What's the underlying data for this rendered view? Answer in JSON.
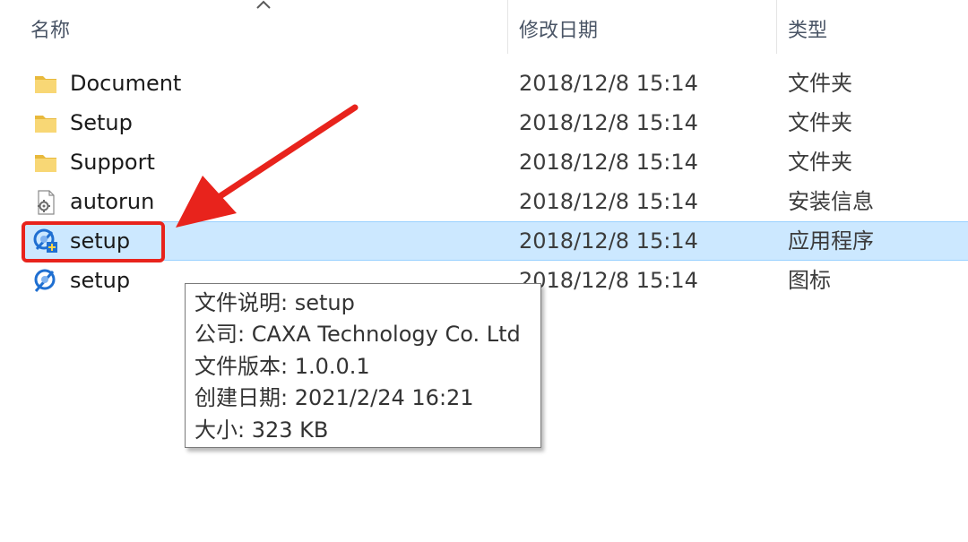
{
  "header": {
    "name_label": "名称",
    "date_label": "修改日期",
    "type_label": "类型"
  },
  "files": [
    {
      "name": "Document",
      "date": "2018/12/8 15:14",
      "type": "文件夹",
      "icon": "folder-icon"
    },
    {
      "name": "Setup",
      "date": "2018/12/8 15:14",
      "type": "文件夹",
      "icon": "folder-icon"
    },
    {
      "name": "Support",
      "date": "2018/12/8 15:14",
      "type": "文件夹",
      "icon": "folder-icon"
    },
    {
      "name": "autorun",
      "date": "2018/12/8 15:14",
      "type": "安装信息",
      "icon": "setup-info-icon"
    },
    {
      "name": "setup",
      "date": "2018/12/8 15:14",
      "type": "应用程序",
      "icon": "caxa-app-icon",
      "selected": true
    },
    {
      "name": "setup",
      "date": "2018/12/8 15:14",
      "type": "图标",
      "icon": "caxa-icon-file-icon"
    }
  ],
  "tooltip": {
    "lines": [
      "文件说明: setup",
      "公司: CAXA Technology Co. Ltd",
      "文件版本: 1.0.0.1",
      "创建日期: 2021/2/24 16:21",
      "大小: 323 KB"
    ]
  },
  "colors": {
    "selection": "#cce8ff",
    "annotation_red": "#e8231c",
    "folder_yellow": "#f8d775"
  }
}
